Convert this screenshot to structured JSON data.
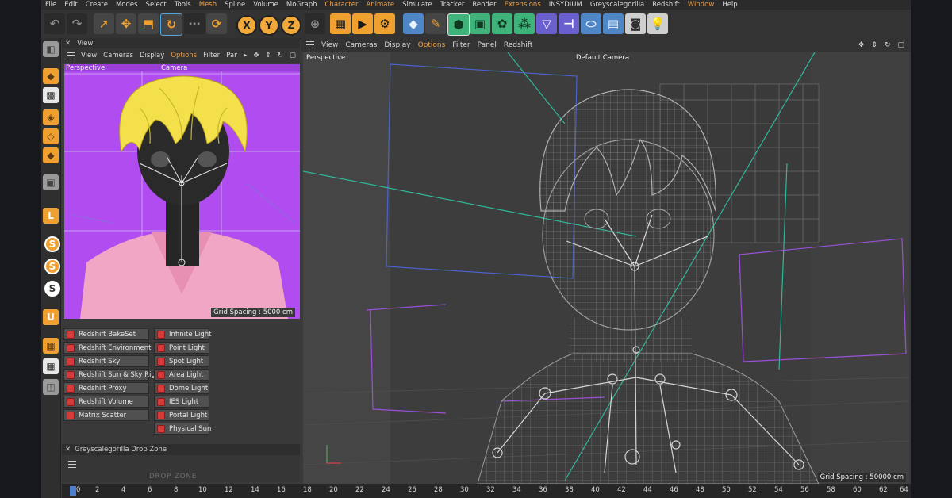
{
  "menu": [
    "File",
    "Edit",
    "Create",
    "Modes",
    "Select",
    "Tools",
    "Mesh",
    "Spline",
    "Volume",
    "MoGraph",
    "Character",
    "Animate",
    "Simulate",
    "Tracker",
    "Render",
    "Extensions",
    "INSYDIUM",
    "Greyscalegorilla",
    "Redshift",
    "Window",
    "Help"
  ],
  "toolbar_axes": [
    "X",
    "Y",
    "Z"
  ],
  "left_viewport": {
    "panel_title": "View",
    "menu": [
      "View",
      "Cameras",
      "Display",
      "Options",
      "Filter",
      "Panel"
    ],
    "label": "Perspective",
    "camera": "Camera",
    "grid": "Grid Spacing : 5000 cm"
  },
  "right_viewport": {
    "menu": [
      "View",
      "Cameras",
      "Display",
      "Options",
      "Filter",
      "Panel",
      "Redshift"
    ],
    "label": "Perspective",
    "camera": "Default Camera",
    "grid": "Grid Spacing : 50000 cm"
  },
  "content_browser": {
    "col1": [
      "Redshift BakeSet",
      "Redshift Environment",
      "Redshift Sky",
      "Redshift Sun & Sky Rig",
      "Redshift Proxy",
      "Redshift Volume",
      "Matrix Scatter"
    ],
    "col2": [
      "Infinite Light",
      "Point Light",
      "Spot Light",
      "Area Light",
      "Dome Light",
      "IES Light",
      "Portal Light",
      "Physical Sun"
    ]
  },
  "drop_zone": {
    "title": "Greyscalegorilla Drop Zone",
    "logo": "DROP ZONE"
  },
  "timeline": [
    "0",
    "2",
    "4",
    "6",
    "8",
    "10",
    "12",
    "14",
    "16",
    "18",
    "20",
    "22",
    "24",
    "26",
    "28",
    "30",
    "32",
    "34",
    "36",
    "38",
    "40",
    "42",
    "44",
    "46",
    "48",
    "50",
    "52",
    "54",
    "56",
    "58",
    "60",
    "62",
    "64"
  ],
  "colors": {
    "accent": "#f0a030",
    "viewport_bg": "#b04cf0",
    "shirt": "#f2a6c6",
    "hair": "#f4e04a"
  }
}
